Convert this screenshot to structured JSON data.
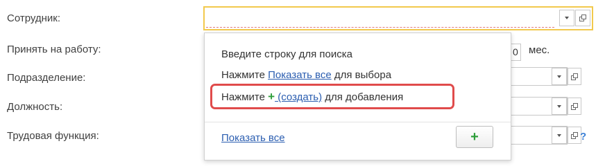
{
  "form": {
    "labels": {
      "employee": "Сотрудник:",
      "hire": "Принять на работу:",
      "department": "Подразделение:",
      "position": "Должность:",
      "labor_function": "Трудовая функция:"
    },
    "employee_value": "",
    "hire_period_value": "0",
    "hire_unit": "мес.",
    "help_symbol": "?"
  },
  "popup": {
    "line1": "Введите строку для поиска",
    "line2_prefix": "Нажмите ",
    "line2_link": "Показать все",
    "line2_suffix": " для выбора",
    "line3_prefix": "Нажмите ",
    "line3_plus": "+",
    "line3_link": " (создать)",
    "line3_suffix": " для добавления",
    "show_all_link": "Показать все",
    "create_button_label": "+"
  },
  "colors": {
    "focus_border": "#f2c94c",
    "highlight": "#e04b4b",
    "link": "#2a5db0",
    "plus": "#2e9e3a",
    "help": "#3a7fd5"
  },
  "icons": {
    "dropdown": "chevron-down-icon",
    "open": "open-form-icon",
    "create": "plus-icon"
  }
}
